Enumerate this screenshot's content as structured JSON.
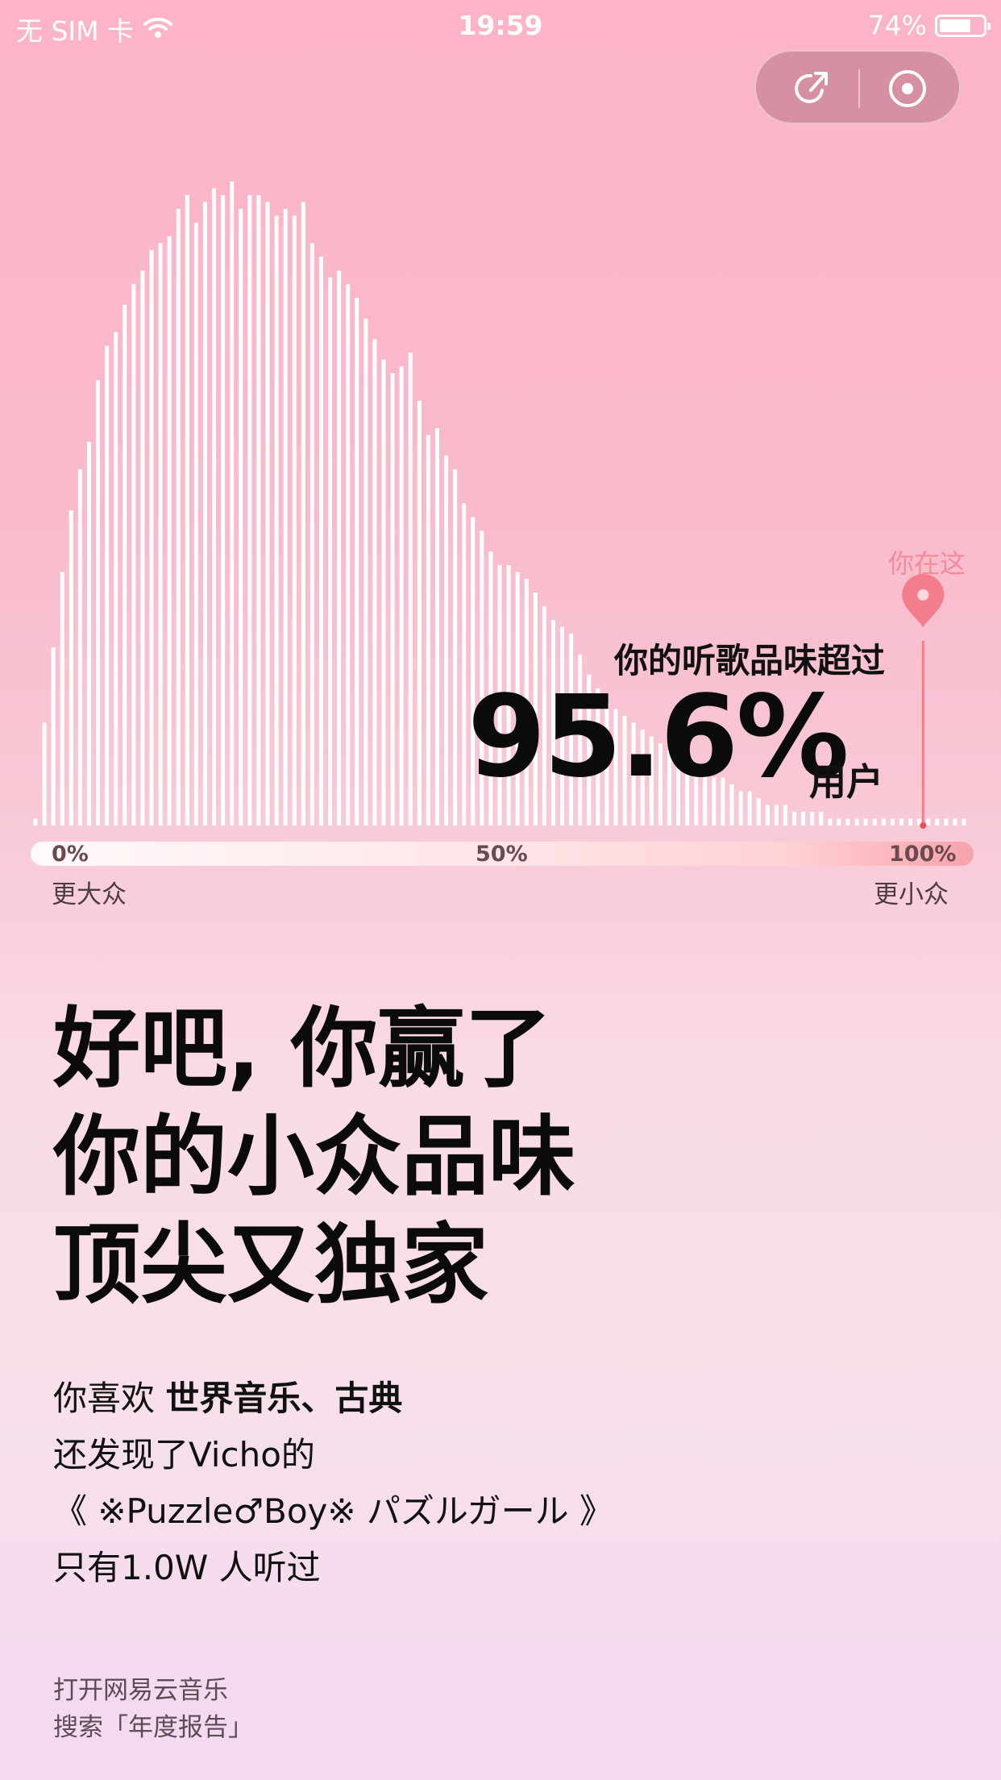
{
  "status_bar": {
    "carrier": "无 SIM 卡",
    "time": "19:59",
    "battery": "74%",
    "battery_level": 0.74
  },
  "capsule": {
    "share_icon": "share-arrow-icon",
    "close_icon": "record-circle-icon"
  },
  "chart_data": {
    "type": "bar",
    "x_ticks": [
      "0%",
      "50%",
      "100%"
    ],
    "x_end_labels": {
      "left": "更大众",
      "right": "更小众"
    },
    "marker_label": "你在这",
    "marker_x_percent": 95.6,
    "values": [
      1,
      15,
      26,
      37,
      46,
      52,
      56,
      65,
      70,
      72,
      76,
      79,
      81,
      84,
      85,
      86,
      90,
      92,
      88,
      91,
      93,
      92,
      94,
      90,
      92,
      92,
      91,
      89,
      90,
      89,
      91,
      85,
      83,
      80,
      81,
      79,
      77,
      74,
      71,
      68,
      66,
      67,
      69,
      62,
      57,
      58,
      54,
      52,
      47,
      45,
      43,
      40,
      38,
      38,
      37,
      36,
      34,
      32,
      30,
      29,
      28,
      25,
      22,
      20,
      18,
      17,
      16,
      15,
      14,
      13,
      12,
      11,
      10,
      10,
      9,
      8,
      7,
      7,
      6,
      5,
      5,
      4,
      3,
      3,
      3,
      2,
      2,
      2,
      2,
      1,
      1,
      1,
      1,
      1,
      1,
      1,
      1,
      1,
      1,
      1,
      1,
      1,
      1,
      1,
      1
    ]
  },
  "stat": {
    "prefix": "你的听歌品味超过",
    "percent": "95.6%",
    "suffix": "用户"
  },
  "headline": [
    "好吧, 你赢了",
    "你的小众品味",
    "顶尖又独家"
  ],
  "detail": {
    "line1_prefix": "你喜欢 ",
    "line1_genres": "世界音乐、古典",
    "line2": "还发现了Vicho的",
    "line3": "《 ※Puzzle♂Boy※ パズルガール 》",
    "line4": "只有1.0W 人听过"
  },
  "footer": {
    "line1": "打开网易云音乐",
    "line2": "搜索「年度报告」"
  },
  "colors": {
    "bar": "#ffffff",
    "marker": "#f47d8c",
    "text": "#111111"
  }
}
